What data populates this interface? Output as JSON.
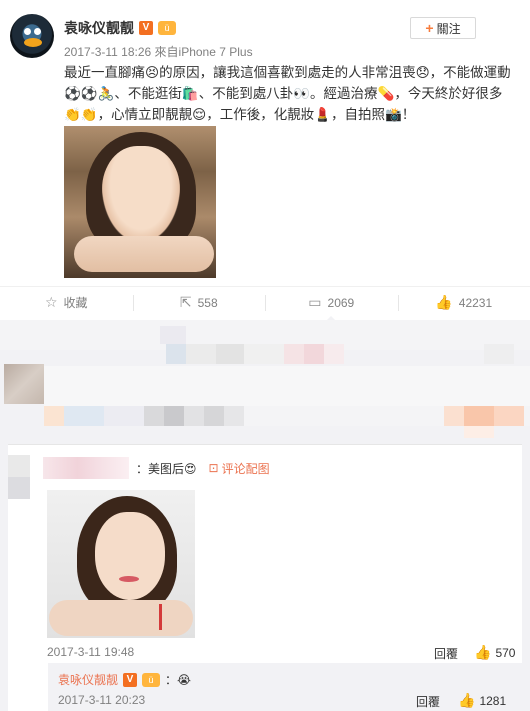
{
  "post": {
    "username": "袁咏仪靓靓",
    "vip_badge": "V",
    "level_badge": "ü",
    "timestamp": "2017-3-11 18:26",
    "source": "來自iPhone 7 Plus",
    "follow_label": "關注",
    "text": "最近一直腳痛😣的原因，讓我這個喜歡到處走的人非常沮喪😞，不能做運動⚽⚽🚴、不能逛街🛍️、不能到處八卦👀。經過治療💊，今天終於好很多👏👏，心情立即靚靚😌，工作後，化靚妝💄，自拍照📸！"
  },
  "actions": {
    "favorite_label": "收藏",
    "repost_count": "558",
    "comment_count": "2069",
    "like_count": "42231"
  },
  "comment": {
    "text": "：美图后😍",
    "comment_photo_label": "评论配图",
    "timestamp": "2017-3-11 19:48",
    "reply_label": "回覆",
    "like_count": "570"
  },
  "sub_reply": {
    "username": "袁咏仪靓靓",
    "vip_badge": "V",
    "level_badge": "ü",
    "text": "：😭",
    "timestamp": "2017-3-11 20:23",
    "reply_label": "回覆",
    "like_count": "1281"
  },
  "colors": {
    "accent": "#eb7350",
    "follow_plus": "#f77c3d",
    "muted_text": "#808080",
    "panel_bg": "#f2f2f5"
  },
  "icons": {
    "favorite": "star-icon",
    "repost": "repost-icon",
    "comment": "comment-icon",
    "like": "thumbs-up-icon",
    "comment_image": "image-icon"
  }
}
